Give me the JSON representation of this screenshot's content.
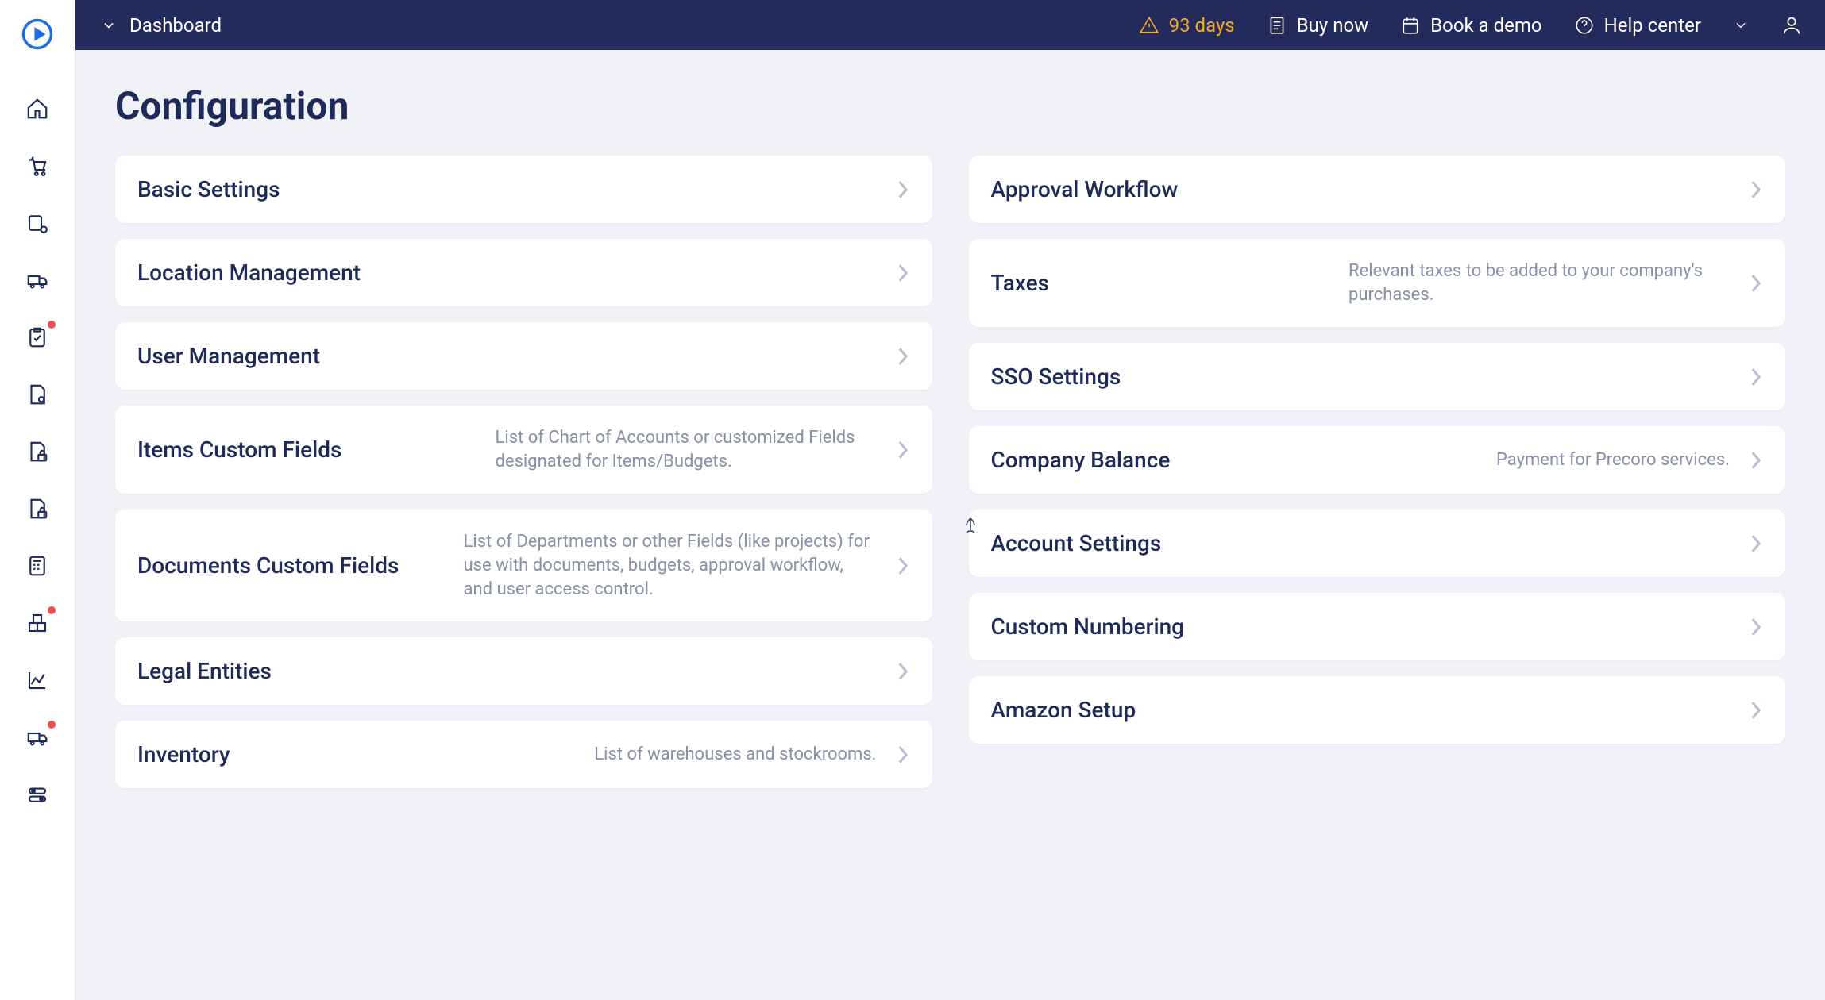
{
  "header": {
    "breadcrumb": "Dashboard",
    "trial_days": "93 days",
    "buy_now": "Buy now",
    "book_demo": "Book a demo",
    "help_center": "Help center"
  },
  "page_title": "Configuration",
  "left_cards": [
    {
      "title": "Basic Settings",
      "desc": ""
    },
    {
      "title": "Location Management",
      "desc": ""
    },
    {
      "title": "User Management",
      "desc": ""
    },
    {
      "title": "Items Custom Fields",
      "desc": "List of Chart of Accounts or customized Fields designated for Items/Budgets."
    },
    {
      "title": "Documents Custom Fields",
      "desc": "List of Departments or other Fields (like projects) for use with documents, budgets, approval workflow, and user access control."
    },
    {
      "title": "Legal Entities",
      "desc": ""
    },
    {
      "title": "Inventory",
      "desc": "List of warehouses and stockrooms."
    }
  ],
  "right_cards": [
    {
      "title": "Approval Workflow",
      "desc": ""
    },
    {
      "title": "Taxes",
      "desc": "Relevant taxes to be added to your company's purchases."
    },
    {
      "title": "SSO Settings",
      "desc": ""
    },
    {
      "title": "Company Balance",
      "desc": "Payment for Precoro services."
    },
    {
      "title": "Account Settings",
      "desc": ""
    },
    {
      "title": "Custom Numbering",
      "desc": ""
    },
    {
      "title": "Amazon Setup",
      "desc": ""
    }
  ]
}
